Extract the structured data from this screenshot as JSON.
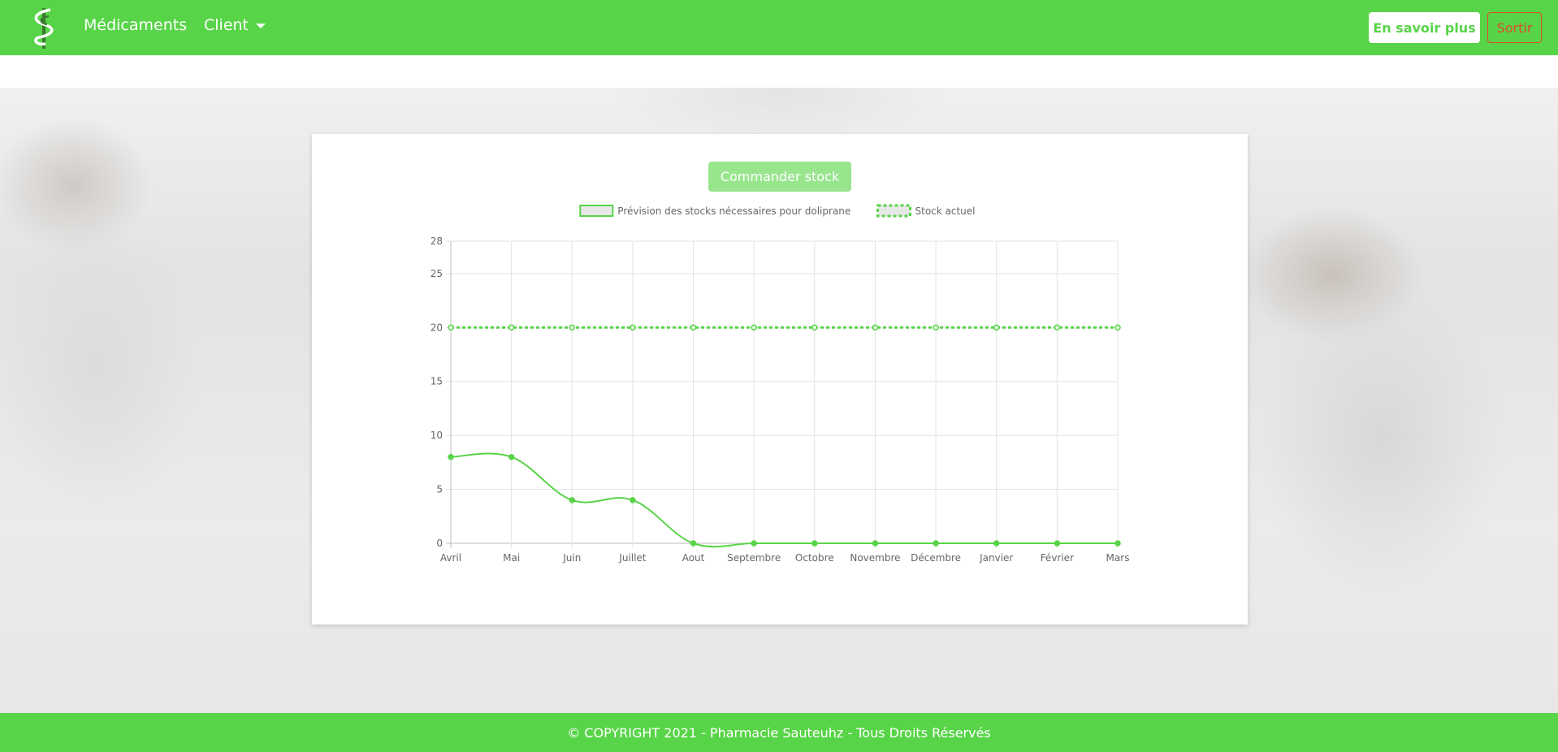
{
  "navbar": {
    "logo_icon": "caduceus-icon",
    "links": [
      {
        "label": "Médicaments"
      },
      {
        "label": "Client",
        "has_dropdown": true
      }
    ],
    "more_label": "En savoir plus",
    "exit_label": "Sortir"
  },
  "main": {
    "order_button_label": "Commander stock"
  },
  "colors": {
    "brand": "#58d448",
    "exit": "#e0492f",
    "series_line": "#58d448",
    "legend_fill": "#e8e8e8"
  },
  "chart_data": {
    "type": "line",
    "title": "",
    "xlabel": "",
    "ylabel": "",
    "categories": [
      "Avril",
      "Mai",
      "Juin",
      "Juillet",
      "Aout",
      "Septembre",
      "Octobre",
      "Novembre",
      "Décembre",
      "Janvier",
      "Février",
      "Mars"
    ],
    "series": [
      {
        "name": "Prévision des stocks nécessaires pour doliprane",
        "values": [
          8,
          8,
          4,
          4,
          0,
          0,
          0,
          0,
          0,
          0,
          0,
          0
        ],
        "style": "solid",
        "smooth": true
      },
      {
        "name": "Stock actuel",
        "values": [
          20,
          20,
          20,
          20,
          20,
          20,
          20,
          20,
          20,
          20,
          20,
          20
        ],
        "style": "dashed"
      }
    ],
    "ylim": [
      0,
      28
    ],
    "yticks": [
      0,
      5,
      10,
      15,
      20,
      25,
      28
    ],
    "grid": true,
    "legend_position": "top"
  },
  "footer": {
    "text": "© COPYRIGHT 2021 - Pharmacie Sauteuhz - Tous Droits Réservés"
  }
}
